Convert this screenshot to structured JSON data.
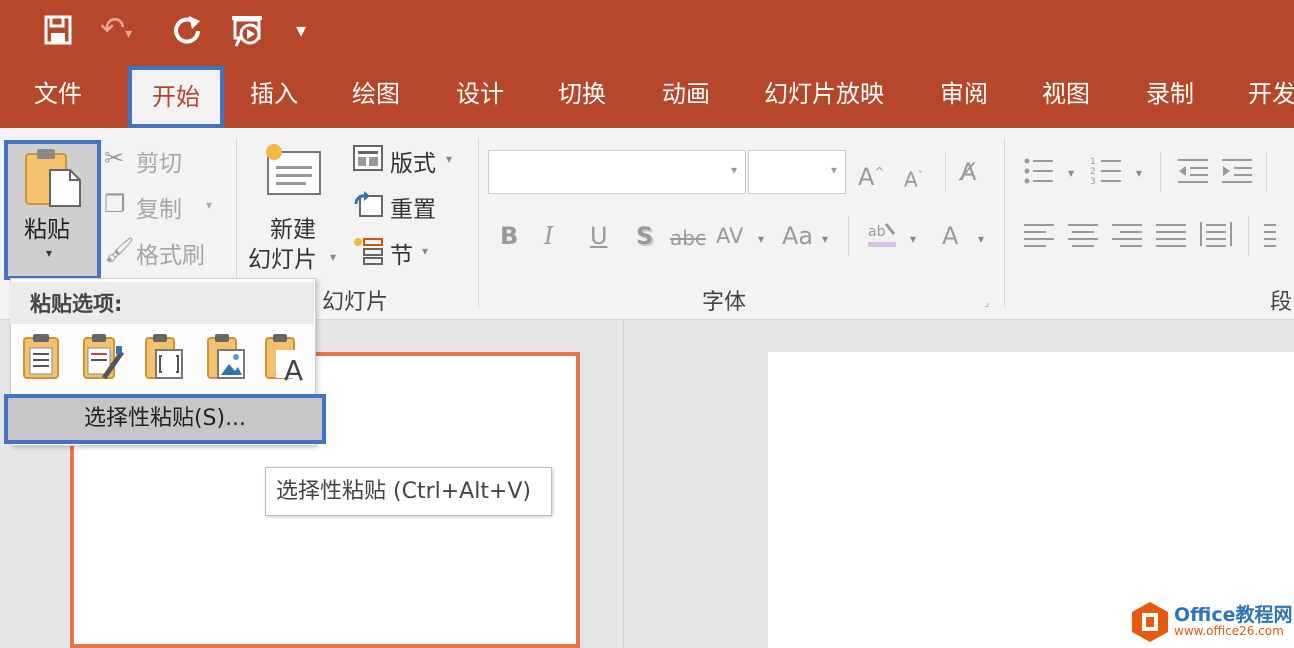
{
  "qat": {
    "save_icon": "save-icon",
    "undo_icon": "undo-icon",
    "redo_icon": "repeat-icon",
    "present_icon": "present-icon",
    "customize": "▾"
  },
  "tabs": [
    {
      "label": "文件"
    },
    {
      "label": "开始"
    },
    {
      "label": "插入"
    },
    {
      "label": "绘图"
    },
    {
      "label": "设计"
    },
    {
      "label": "切换"
    },
    {
      "label": "动画"
    },
    {
      "label": "幻灯片放映"
    },
    {
      "label": "审阅"
    },
    {
      "label": "视图"
    },
    {
      "label": "录制"
    },
    {
      "label": "开发"
    }
  ],
  "clipboard": {
    "paste": "粘贴",
    "cut": "剪切",
    "copy": "复制",
    "format_painter": "格式刷"
  },
  "slides": {
    "new_slide_line1": "新建",
    "new_slide_line2": "幻灯片",
    "layout": "版式",
    "reset": "重置",
    "section": "节",
    "group_label": "幻灯片"
  },
  "font": {
    "group_label": "字体",
    "font_name": "",
    "font_size": "",
    "bold": "B",
    "italic": "I",
    "underline": "U",
    "shadow": "S",
    "strike": "abc",
    "spacing": "AV",
    "case": "Aa",
    "color": "A"
  },
  "paragraph": {
    "group_label": "段"
  },
  "paste_menu": {
    "title": "粘贴选项:",
    "special_paste": "选择性粘贴(S)..."
  },
  "tooltip": {
    "text": "选择性粘贴 (Ctrl+Alt+V)"
  },
  "watermark": {
    "brand": "Office教程网",
    "url": "www.office26.com"
  },
  "colors": {
    "accent": "#b7472a",
    "highlight": "#4472c4",
    "thumb_border": "#e9734f",
    "logo": "#e8590c"
  }
}
